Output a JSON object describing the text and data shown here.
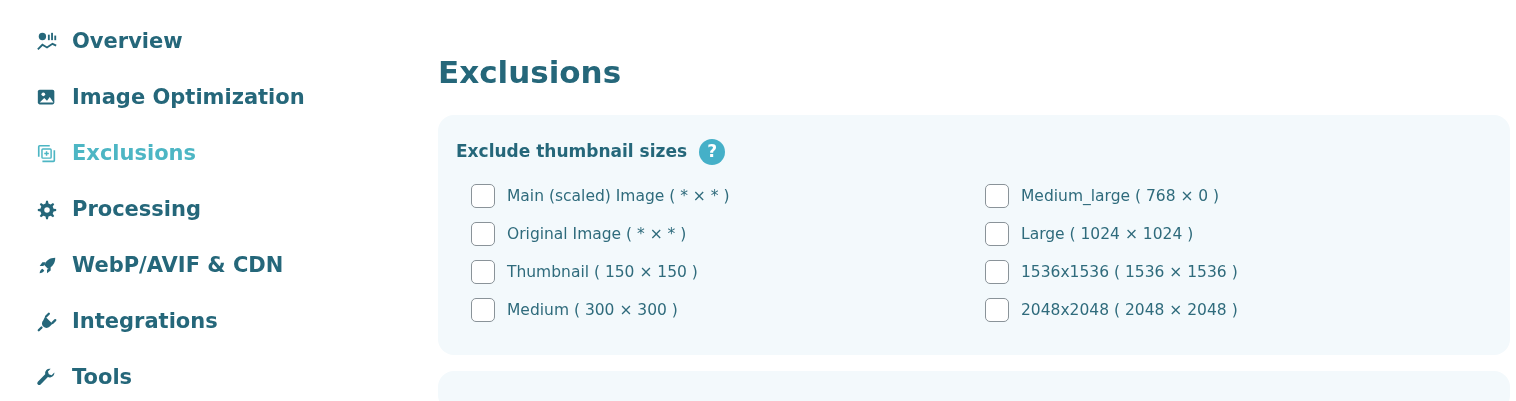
{
  "sidebar": {
    "items": [
      {
        "label": "Overview",
        "kind": "chart",
        "selected": false
      },
      {
        "label": "Image Optimization",
        "kind": "image",
        "selected": false
      },
      {
        "label": "Exclusions",
        "kind": "exclude",
        "selected": true
      },
      {
        "label": "Processing",
        "kind": "gear",
        "selected": false
      },
      {
        "label": "WebP/AVIF & CDN",
        "kind": "rocket",
        "selected": false
      },
      {
        "label": "Integrations",
        "kind": "plug",
        "selected": false
      },
      {
        "label": "Tools",
        "kind": "wrench",
        "selected": false
      }
    ]
  },
  "page_title": "Exclusions",
  "thumbnail_section": {
    "title": "Exclude thumbnail sizes",
    "help": "?",
    "options": [
      {
        "label": "Main (scaled) Image ( * × * )",
        "checked": false
      },
      {
        "label": "Original Image ( * × * )",
        "checked": false
      },
      {
        "label": "Thumbnail ( 150 × 150 )",
        "checked": false
      },
      {
        "label": "Medium ( 300 × 300 )",
        "checked": false
      },
      {
        "label": "Medium_large ( 768 × 0 )",
        "checked": false
      },
      {
        "label": "Large ( 1024 × 1024 )",
        "checked": false
      },
      {
        "label": "1536x1536 ( 1536 × 1536 )",
        "checked": false
      },
      {
        "label": "2048x2048 ( 2048 × 2048 )",
        "checked": false
      }
    ]
  }
}
